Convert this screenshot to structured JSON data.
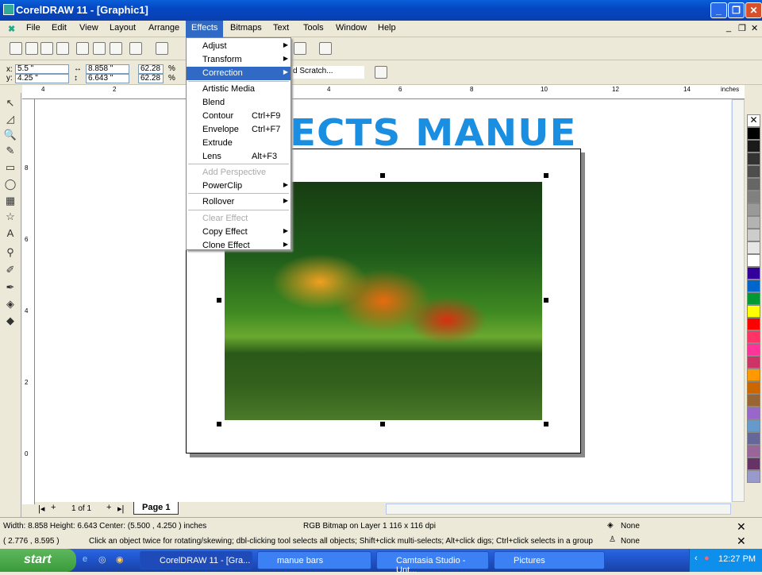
{
  "window": {
    "title": "CorelDRAW 11 - [Graphic1]"
  },
  "menubar": [
    "File",
    "Edit",
    "View",
    "Layout",
    "Arrange",
    "Effects",
    "Bitmaps",
    "Text",
    "Tools",
    "Window",
    "Help"
  ],
  "property_bar": {
    "x": "5.5 \"",
    "y": "4.25 \"",
    "x_label": "x:",
    "y_label": "y:",
    "width": "8.858 \"",
    "height": "6.643 \"",
    "scale_x": "62.28",
    "scale_y": "62.28",
    "pct": "%",
    "partial_item": "d Scratch..."
  },
  "effects_menu": [
    {
      "label": "Adjust",
      "submenu": true
    },
    {
      "label": "Transform",
      "submenu": true
    },
    {
      "label": "Correction",
      "submenu": true,
      "highlighted": true
    },
    {
      "label": "Artistic Media"
    },
    {
      "label": "Blend"
    },
    {
      "label": "Contour",
      "shortcut": "Ctrl+F9"
    },
    {
      "label": "Envelope",
      "shortcut": "Ctrl+F7"
    },
    {
      "label": "Extrude"
    },
    {
      "label": "Lens",
      "shortcut": "Alt+F3"
    },
    {
      "label": "Add Perspective",
      "disabled": true
    },
    {
      "label": "PowerClip",
      "submenu": true
    },
    {
      "label": "Rollover",
      "submenu": true
    },
    {
      "label": "Clear Effect",
      "disabled": true
    },
    {
      "label": "Copy Effect",
      "submenu": true
    },
    {
      "label": "Clone Effect",
      "submenu": true
    }
  ],
  "ruler": {
    "h_labels": [
      "4",
      "2",
      "4",
      "6",
      "8",
      "10",
      "12",
      "14"
    ],
    "units": "inches",
    "v_labels": [
      "8",
      "6",
      "4",
      "2",
      "0"
    ]
  },
  "canvas": {
    "heading": "ECTS MANUE"
  },
  "page_nav": {
    "count": "1 of 1",
    "tab": "Page 1"
  },
  "status": {
    "dims": "Width: 8.858  Height: 6.643  Center: (5.500 , 4.250 )  inches",
    "object": "RGB Bitmap on Layer 1 116 x 116 dpi",
    "coords": "( 2.776 , 8.595 )",
    "hint": "Click an object twice for rotating/skewing; dbl-clicking tool selects all objects; Shift+click multi-selects; Alt+click digs; Ctrl+click selects in a group",
    "fill": "None",
    "outline": "None"
  },
  "palette": [
    "#ffffff",
    "#000000",
    "#1a1a1a",
    "#333333",
    "#4d4d4d",
    "#666666",
    "#808080",
    "#999999",
    "#b3b3b3",
    "#cccccc",
    "#e6e6e6",
    "#ffffff",
    "#330099",
    "#0066cc",
    "#009933",
    "#ffff00",
    "#ff0000",
    "#ff3366",
    "#ff3399",
    "#cc3366",
    "#ff9900",
    "#cc6600",
    "#996633",
    "#9966cc",
    "#6699cc",
    "#666699",
    "#996699",
    "#663366",
    "#9999cc"
  ],
  "taskbar": {
    "start": "start",
    "tasks": [
      "CorelDRAW 11 - [Gra...",
      "manue bars",
      "Camtasia Studio - Unt...",
      "Pictures"
    ],
    "clock": "12:27 PM"
  }
}
